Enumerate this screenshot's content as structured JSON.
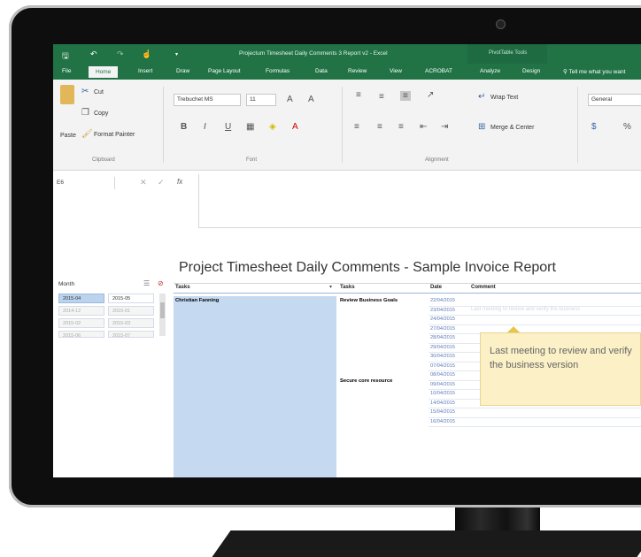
{
  "window": {
    "document_title": "Projectum Timesheet Daily Comments 3 Report v2 - Excel",
    "context_tab": "PivotTable Tools",
    "tell_me": "Tell me what you want"
  },
  "tabs": [
    "File",
    "Home",
    "Insert",
    "Draw",
    "Page Layout",
    "Formulas",
    "Data",
    "Review",
    "View",
    "ACROBAT",
    "Analyze",
    "Design"
  ],
  "ribbon": {
    "clipboard": {
      "paste": "Paste",
      "cut": "Cut",
      "copy": "Copy",
      "format_painter": "Format Painter",
      "group": "Clipboard"
    },
    "font": {
      "name": "Trebuchet MS",
      "size": "11",
      "group": "Font"
    },
    "alignment": {
      "wrap": "Wrap Text",
      "merge": "Merge & Center",
      "group": "Alignment"
    },
    "number": {
      "format": "General",
      "percent": "%"
    }
  },
  "formula_bar": {
    "name_box": "E6",
    "fx": "fx"
  },
  "report": {
    "title": "Project Timesheet Daily Comments - Sample Invoice Report"
  },
  "slicer": {
    "title": "Month",
    "items": [
      {
        "label": "2015-04",
        "state": "selected"
      },
      {
        "label": "2015-05",
        "state": "normal"
      },
      {
        "label": "2014-12",
        "state": "dim"
      },
      {
        "label": "2015-01",
        "state": "dim"
      },
      {
        "label": "2015-02",
        "state": "dim"
      },
      {
        "label": "2015-03",
        "state": "dim"
      },
      {
        "label": "2015-06",
        "state": "dim"
      },
      {
        "label": "2015-07",
        "state": "dim"
      }
    ]
  },
  "table": {
    "headers": {
      "name": "Tasks",
      "task": "Tasks",
      "date": "Date",
      "comment": "Comment"
    },
    "resource": "Christian Fanning",
    "tasks": [
      "Review Business Goals",
      "Secure core resource"
    ],
    "dates": [
      "22/04/2015",
      "23/04/2015",
      "24/04/2015",
      "27/04/2015",
      "28/04/2015",
      "29/04/2015",
      "30/04/2015",
      "07/04/2015",
      "08/04/2015",
      "09/04/2015",
      "10/04/2015",
      "14/04/2015",
      "15/04/2015",
      "16/04/2015"
    ],
    "faded_comment": "Last meeting to review and verify the business"
  },
  "callout": {
    "text": "Last meeting  to review  and verify the business version"
  }
}
